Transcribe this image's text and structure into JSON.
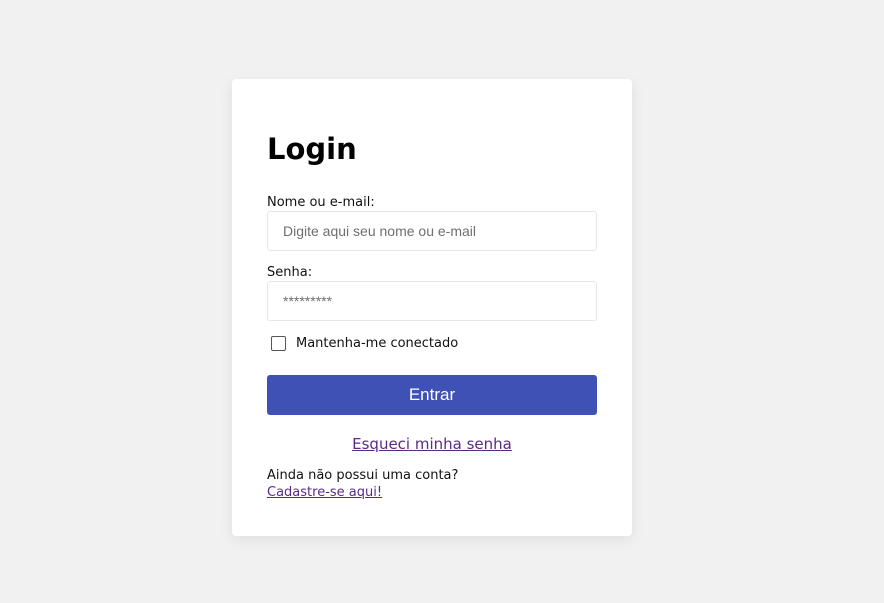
{
  "login": {
    "title": "Login",
    "username_label": "Nome ou e-mail:",
    "username_placeholder": "Digite aqui seu nome ou e-mail",
    "password_label": "Senha:",
    "password_placeholder": "*********",
    "remember_label": "Mantenha-me conectado",
    "remember_checked": false,
    "submit_label": "Entrar",
    "forgot_link": "Esqueci minha senha",
    "no_account_text": "Ainda não possui uma conta?",
    "signup_link": "Cadastre-se aqui!"
  },
  "colors": {
    "background": "#f1f1f1",
    "card": "#ffffff",
    "primary_button": "#3f51b5",
    "link": "#5b2a86"
  }
}
